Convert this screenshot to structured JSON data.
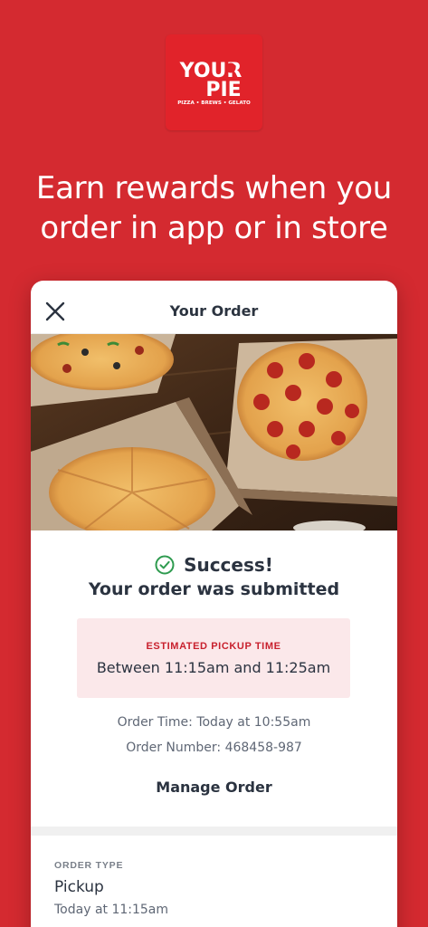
{
  "brand": {
    "logo_line1": "YOUR",
    "logo_line2": "PIE",
    "logo_tagline": "PIZZA • BREWS • GELATO",
    "accent": "#d42a30"
  },
  "promo": {
    "headline_line1": "Earn rewards when you",
    "headline_line2": "order in app or in store"
  },
  "screen": {
    "title": "Your Order",
    "close_icon": "close-icon",
    "hero_image": "pizzas-in-boxes-photo",
    "success_icon": "check-circle-icon",
    "success_title": "Success!",
    "success_subtitle": "Your order was submitted",
    "pickup": {
      "label": "ESTIMATED PICKUP TIME",
      "value": "Between 11:15am and 11:25am"
    },
    "order_time": "Order Time: Today at 10:55am",
    "order_number": "Order Number: 468458-987",
    "manage_label": "Manage Order",
    "order_type": {
      "label": "ORDER TYPE",
      "value": "Pickup",
      "time": "Today at 11:15am"
    }
  }
}
